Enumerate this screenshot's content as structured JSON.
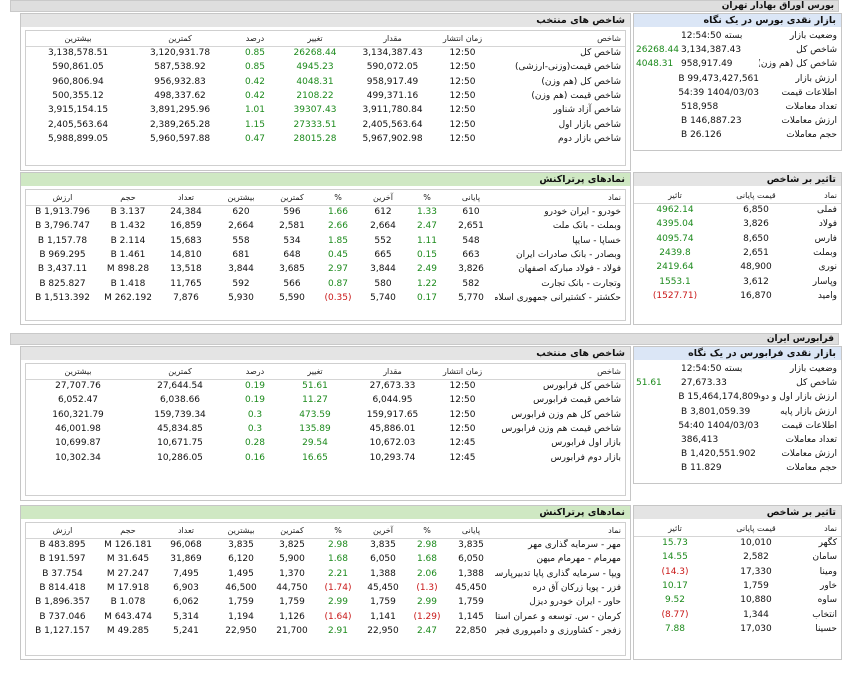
{
  "colors": {
    "green": "#1c8a1c",
    "red": "#c91818",
    "blue_header": "#dbe6f6",
    "green_header": "#cfe8c3"
  },
  "bourse": {
    "section_title": "بورس اوراق بهادار تهران",
    "indices": {
      "title": "شاخص های منتخب",
      "headers": [
        "شاخص",
        "زمان انتشار",
        "مقدار",
        "تغییر",
        "درصد",
        "کمترین",
        "بیشترین"
      ],
      "rows": [
        [
          "شاخص کل",
          "12:50",
          "3,134,387.43",
          "26268.44",
          "0.85",
          "3,120,931.78",
          "3,138,578.51"
        ],
        [
          "شاخص قیمت(وزنی-ارزشی)",
          "12:50",
          "590,072.05",
          "4945.23",
          "0.85",
          "587,538.92",
          "590,861.05"
        ],
        [
          "شاخص کل (هم وزن)",
          "12:50",
          "958,917.49",
          "4048.31",
          "0.42",
          "956,932.83",
          "960,806.94"
        ],
        [
          "شاخص قیمت (هم وزن)",
          "12:50",
          "499,371.16",
          "2108.22",
          "0.42",
          "498,337.62",
          "500,355.12"
        ],
        [
          "شاخص آزاد شناور",
          "12:50",
          "3,911,780.84",
          "39307.43",
          "1.01",
          "3,891,295.96",
          "3,915,154.15"
        ],
        [
          "شاخص بازار اول",
          "12:50",
          "2,405,563.64",
          "27333.51",
          "1.15",
          "2,389,265.28",
          "2,405,563.64"
        ],
        [
          "شاخص بازار دوم",
          "12:50",
          "5,967,902.98",
          "28015.28",
          "0.47",
          "5,960,597.88",
          "5,988,899.05"
        ]
      ]
    },
    "market": {
      "title": "بازار نقدی بورس در یک نگاه",
      "rows": [
        {
          "label": "وضعیت بازار",
          "value": "بسته 12:54:50",
          "change": ""
        },
        {
          "label": "شاخص کل",
          "value": "3,134,387.43",
          "change": "26268.44"
        },
        {
          "label": "شاخص کل (هم وزن)",
          "value": "958,917.49",
          "change": "4048.31"
        },
        {
          "label": "ارزش بازار",
          "value": "99,473,427,561 B",
          "change": ""
        },
        {
          "label": "اطلاعات قیمت",
          "value": "1404/03/03 12:54:39",
          "change": ""
        },
        {
          "label": "تعداد معاملات",
          "value": "518,958",
          "change": ""
        },
        {
          "label": "ارزش معاملات",
          "value": "146,887.23 B",
          "change": ""
        },
        {
          "label": "حجم معاملات",
          "value": "26.126 B",
          "change": ""
        }
      ]
    },
    "symbols": {
      "title": "نمادهای پرتراکنش",
      "headers": [
        "نماد",
        "پایانی",
        "%",
        "آخرین",
        "%",
        "کمترین",
        "بیشترین",
        "تعداد",
        "حجم",
        "ارزش"
      ],
      "rows": [
        [
          "خودرو - ایران خودرو",
          "610",
          "1.33",
          "612",
          "1.66",
          "596",
          "620",
          "24,384",
          "3.137 B",
          "1,913.796 B"
        ],
        [
          "وبملت - بانک ملت",
          "2,651",
          "2.47",
          "2,664",
          "2.66",
          "2,581",
          "2,664",
          "16,859",
          "1.432 B",
          "3,796.747 B"
        ],
        [
          "خساپا - سایپا",
          "548",
          "1.11",
          "552",
          "1.85",
          "534",
          "558",
          "15,683",
          "2.114 B",
          "1,157.78 B"
        ],
        [
          "وبصادر - بانک صادرات ایران",
          "663",
          "0.15",
          "665",
          "0.45",
          "648",
          "681",
          "14,810",
          "1.461 B",
          "969.295 B"
        ],
        [
          "فولاد - فولاد مبارکه اصفهان",
          "3,826",
          "2.49",
          "3,844",
          "2.97",
          "3,685",
          "3,844",
          "13,518",
          "898.28 M",
          "3,437.11 B"
        ],
        [
          "وتجارت - بانک تجارت",
          "582",
          "1.22",
          "580",
          "0.87",
          "566",
          "592",
          "11,765",
          "1.418 B",
          "825.827 B"
        ],
        [
          "حکشتر - کشتیرانی جمهوری اسلامی ایران",
          "5,770",
          "0.17",
          "5,740",
          "(0.35)",
          "5,590",
          "5,930",
          "7,876",
          "262.192 M",
          "1,513.392 B"
        ]
      ]
    },
    "impact": {
      "title": "تاثیر بر شاخص",
      "headers": [
        "نماد",
        "قیمت پایانی",
        "تاثیر"
      ],
      "rows": [
        [
          "فملی",
          "6,850",
          "4962.14"
        ],
        [
          "فولاد",
          "3,826",
          "4395.04"
        ],
        [
          "فارس",
          "8,650",
          "4095.74"
        ],
        [
          "وبملت",
          "2,651",
          "2439.8"
        ],
        [
          "نوری",
          "48,900",
          "2419.64"
        ],
        [
          "وپاسار",
          "3,612",
          "1553.1"
        ],
        [
          "وامید",
          "16,870",
          "(1527.71)"
        ]
      ]
    }
  },
  "farabourse": {
    "section_title": "فرابورس ایران",
    "indices": {
      "title": "شاخص های منتخب",
      "headers": [
        "شاخص",
        "زمان انتشار",
        "مقدار",
        "تغییر",
        "درصد",
        "کمترین",
        "بیشترین"
      ],
      "rows": [
        [
          "شاخص کل فرابورس",
          "12:50",
          "27,673.33",
          "51.61",
          "0.19",
          "27,644.54",
          "27,707.76"
        ],
        [
          "شاخص قیمت فرابورس",
          "12:50",
          "6,044.95",
          "11.27",
          "0.19",
          "6,038.66",
          "6,052.47"
        ],
        [
          "شاخص کل هم وزن فرابورس",
          "12:50",
          "159,917.65",
          "473.59",
          "0.3",
          "159,739.34",
          "160,321.79"
        ],
        [
          "شاخص قیمت هم وزن فرابورس",
          "12:50",
          "45,886.01",
          "135.89",
          "0.3",
          "45,834.85",
          "46,001.98"
        ],
        [
          "بازار اول فرابورس",
          "12:45",
          "10,672.03",
          "29.54",
          "0.28",
          "10,671.75",
          "10,699.87"
        ],
        [
          "بازار دوم فرابورس",
          "12:45",
          "10,293.74",
          "16.65",
          "0.16",
          "10,286.05",
          "10,302.34"
        ]
      ]
    },
    "market": {
      "title": "بازار نقدی فرابورس در یک نگاه",
      "rows": [
        {
          "label": "وضعیت بازار",
          "value": "بسته 12:54:50",
          "change": ""
        },
        {
          "label": "شاخص کل",
          "value": "27,673.33",
          "change": "51.61"
        },
        {
          "label": "ارزش بازار اول و دوم",
          "value": "15,464,174,809 B",
          "change": ""
        },
        {
          "label": "ارزش بازار پایه",
          "value": "3,801,059.39 B",
          "change": ""
        },
        {
          "label": "اطلاعات قیمت",
          "value": "1404/03/03 12:54:40",
          "change": ""
        },
        {
          "label": "تعداد معاملات",
          "value": "386,413",
          "change": ""
        },
        {
          "label": "ارزش معاملات",
          "value": "1,420,551.902 B",
          "change": ""
        },
        {
          "label": "حجم معاملات",
          "value": "11.829 B",
          "change": ""
        }
      ]
    },
    "symbols": {
      "title": "نمادهای پرتراکنش",
      "headers": [
        "نماد",
        "پایانی",
        "%",
        "آخرین",
        "%",
        "کمترین",
        "بیشترین",
        "تعداد",
        "حجم",
        "ارزش"
      ],
      "rows": [
        [
          "مهر - سرمایه گذاری مهر",
          "3,835",
          "2.98",
          "3,835",
          "2.98",
          "3,825",
          "3,835",
          "96,068",
          "126.181 M",
          "483.895 B"
        ],
        [
          "مهرمام - مهرمام میهن",
          "6,050",
          "1.68",
          "6,050",
          "1.68",
          "5,900",
          "6,120",
          "31,869",
          "31.645 M",
          "191.597 B"
        ],
        [
          "ویپا - سرمایه گذاری پایا تدبیرپارسا",
          "1,388",
          "2.06",
          "1,388",
          "2.21",
          "1,370",
          "1,495",
          "7,495",
          "27.247 M",
          "37.754 B"
        ],
        [
          "فزر - پویا زرکان آق دره",
          "45,450",
          "(1.3)",
          "45,450",
          "(1.74)",
          "44,750",
          "46,500",
          "6,903",
          "17.918 M",
          "814.418 B"
        ],
        [
          "حاور - ایران خودرو دیزل",
          "1,759",
          "2.99",
          "1,759",
          "2.99",
          "1,759",
          "1,759",
          "6,062",
          "1.078 B",
          "1,896.357 B"
        ],
        [
          "کرمان - س. توسعه و عمران استان کرمان",
          "1,145",
          "(1.29)",
          "1,141",
          "(1.64)",
          "1,126",
          "1,194",
          "5,314",
          "643.474 M",
          "737.046 B"
        ],
        [
          "زفجر - کشاورزی و دامپروری فجر اصفهان",
          "22,850",
          "2.47",
          "22,950",
          "2.91",
          "21,700",
          "22,950",
          "5,241",
          "49.285 M",
          "1,127.157 B"
        ]
      ]
    },
    "impact": {
      "title": "تاثیر بر شاخص",
      "headers": [
        "نماد",
        "قیمت پایانی",
        "تاثیر"
      ],
      "rows": [
        [
          "کگهر",
          "10,010",
          "15.73"
        ],
        [
          "سامان",
          "2,582",
          "14.55"
        ],
        [
          "ومینا",
          "17,330",
          "(14.3)"
        ],
        [
          "خاور",
          "1,759",
          "10.17"
        ],
        [
          "ساوه",
          "10,880",
          "9.52"
        ],
        [
          "انتخاب",
          "1,344",
          "(8.77)"
        ],
        [
          "حسینا",
          "17,030",
          "7.88"
        ]
      ]
    }
  }
}
